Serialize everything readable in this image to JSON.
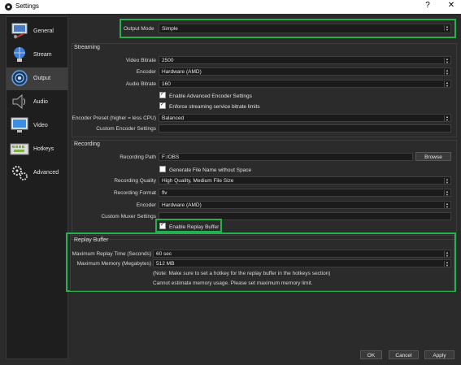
{
  "window": {
    "title": "Settings",
    "help": "?",
    "close": "✕"
  },
  "sidebar": {
    "items": [
      {
        "label": "General",
        "icon": "gear-monitor-icon"
      },
      {
        "label": "Stream",
        "icon": "stream-globe-icon"
      },
      {
        "label": "Output",
        "icon": "output-signal-icon",
        "active": true
      },
      {
        "label": "Audio",
        "icon": "speaker-icon"
      },
      {
        "label": "Video",
        "icon": "monitor-icon"
      },
      {
        "label": "Hotkeys",
        "icon": "keyboard-icon"
      },
      {
        "label": "Advanced",
        "icon": "gears-icon"
      }
    ]
  },
  "output_mode": {
    "label": "Output Mode",
    "value": "Simple"
  },
  "streaming": {
    "title": "Streaming",
    "video_bitrate": {
      "label": "Video Bitrate",
      "value": "2500"
    },
    "encoder": {
      "label": "Encoder",
      "value": "Hardware (AMD)"
    },
    "audio_bitrate": {
      "label": "Audio Bitrate",
      "value": "160"
    },
    "enable_advanced": {
      "label": "Enable Advanced Encoder Settings",
      "checked": true
    },
    "enforce_limits": {
      "label": "Enforce streaming service bitrate limits",
      "checked": true
    },
    "encoder_preset": {
      "label": "Encoder Preset (higher = less CPU)",
      "value": "Balanced"
    },
    "custom_encoder": {
      "label": "Custom Encoder Settings",
      "value": ""
    }
  },
  "recording": {
    "title": "Recording",
    "path": {
      "label": "Recording Path",
      "value": "F:/OBS"
    },
    "browse": "Browse",
    "no_space": {
      "label": "Generate File Name without Space",
      "checked": false
    },
    "quality": {
      "label": "Recording Quality",
      "value": "High Quality, Medium File Size"
    },
    "format": {
      "label": "Recording Format",
      "value": "flv"
    },
    "encoder": {
      "label": "Encoder",
      "value": "Hardware (AMD)"
    },
    "muxer": {
      "label": "Custom Muxer Settings",
      "value": ""
    },
    "replay_enable": {
      "label": "Enable Replay Buffer",
      "checked": true
    }
  },
  "replay_buffer": {
    "title": "Replay Buffer",
    "max_time": {
      "label": "Maximum Replay Time (Seconds)",
      "value": "60 sec"
    },
    "max_memory": {
      "label": "Maximum Memory (Megabytes)",
      "value": "512 MB"
    },
    "note1": "(Note: Make sure to set a hotkey for the replay buffer in the hotkeys section)",
    "note2": "Cannot estimate memory usage.  Please set maximum memory limit."
  },
  "footer": {
    "ok": "OK",
    "cancel": "Cancel",
    "apply": "Apply"
  },
  "colors": {
    "highlight": "#22b14c",
    "background": "#2b2b2b",
    "field": "#1b1b1b"
  }
}
